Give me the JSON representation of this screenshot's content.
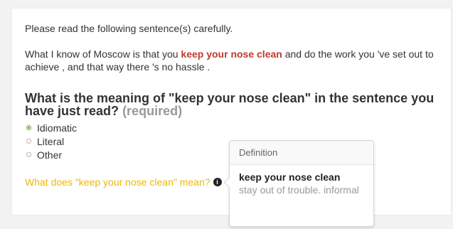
{
  "prompt": {
    "instruction": "Please read the following sentence(s) carefully.",
    "sentence_before": "What I know of Moscow is that you ",
    "sentence_phrase": "keep your nose clean",
    "sentence_after": " and do the work you 've set out to achieve , and that way there 's no hassle ."
  },
  "question": {
    "text": "What is the meaning of \"keep your nose clean\" in the sentence you have just read?",
    "required_label": "(required)"
  },
  "options": [
    {
      "label": "Idiomatic",
      "selected": true
    },
    {
      "label": "Literal",
      "selected": false
    },
    {
      "label": "Other",
      "selected": false
    }
  ],
  "followup": {
    "text": "What does \"keep your nose clean\" mean?",
    "icon": "info-icon"
  },
  "popover": {
    "header": "Definition",
    "term": "keep your nose clean",
    "definition": "stay out of trouble. informal"
  },
  "colors": {
    "highlight": "#c0392b",
    "followup": "#e8b90c",
    "radio_selected": "#6aa84f"
  }
}
